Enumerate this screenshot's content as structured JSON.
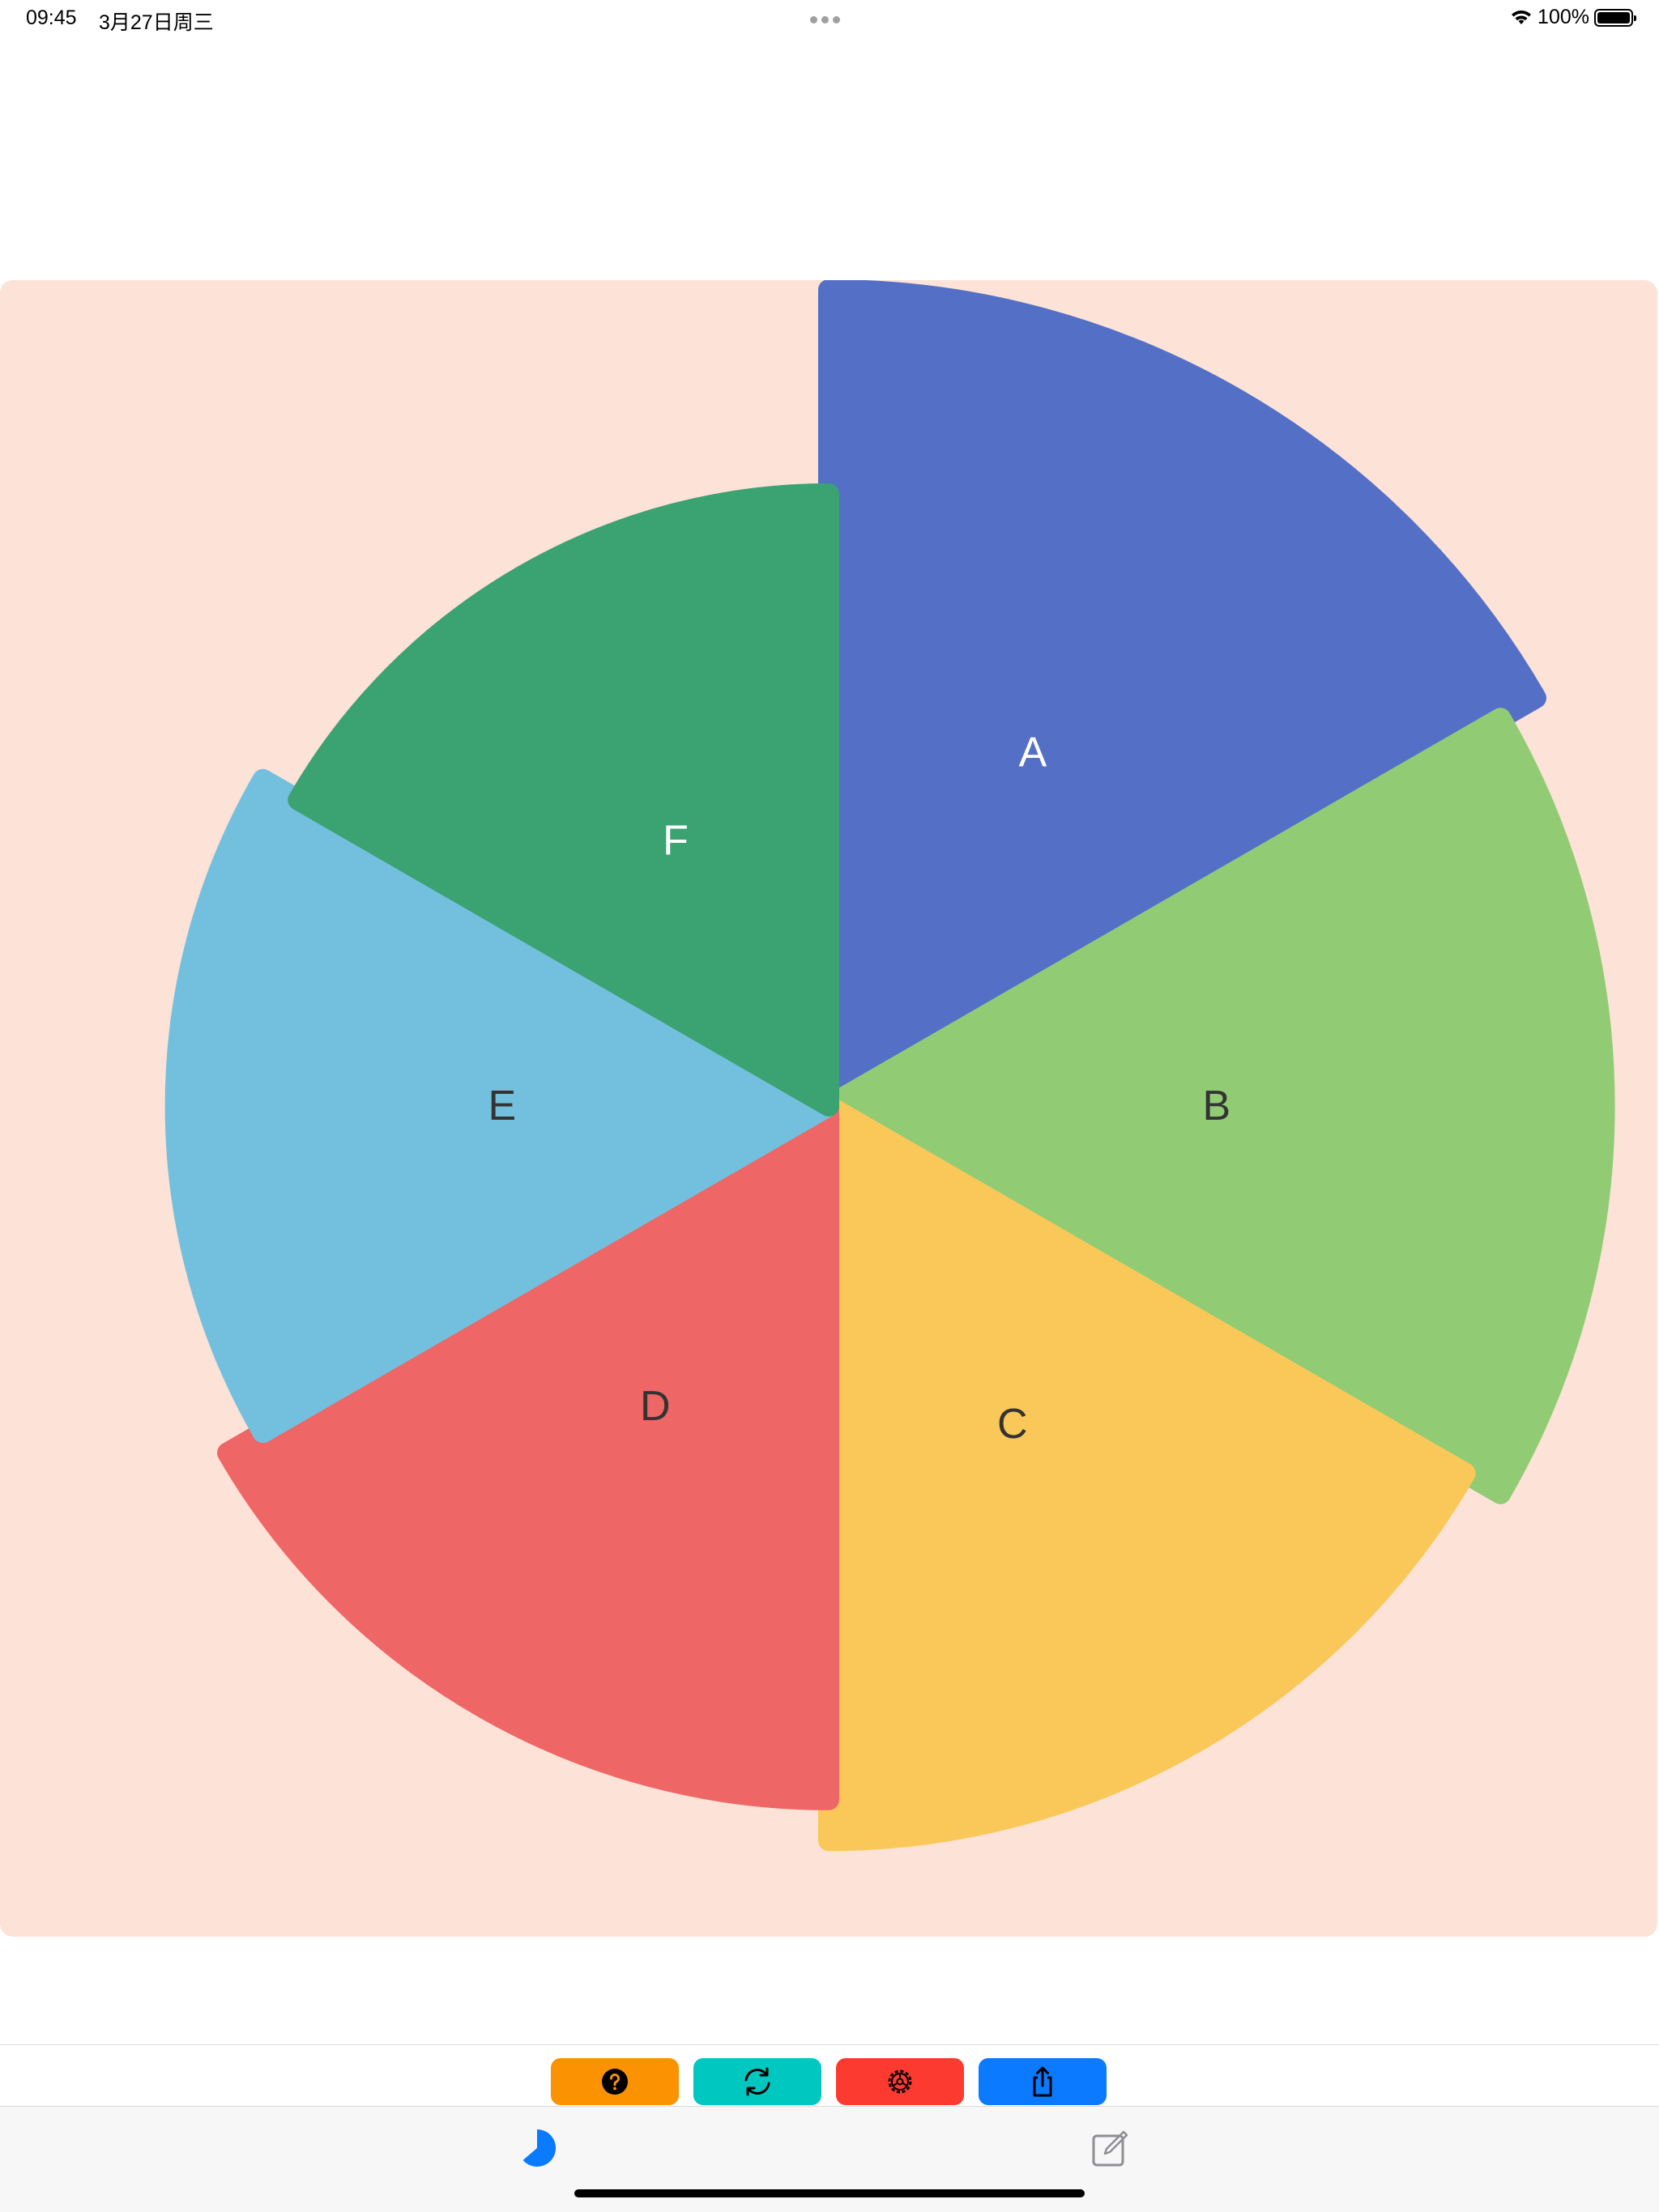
{
  "status_bar": {
    "time": "09:45",
    "date": "3月27日周三",
    "battery": "100%"
  },
  "chart_data": {
    "type": "pie",
    "variant": "nightingale-rose",
    "categories": [
      "A",
      "B",
      "C",
      "D",
      "E",
      "F"
    ],
    "values": [
      100,
      90,
      80,
      70,
      60,
      50
    ],
    "colors": [
      "#5470c6",
      "#91cc75",
      "#fac858",
      "#ee6666",
      "#73c0de",
      "#3ba272"
    ],
    "label_colors": [
      "#ffffff",
      "#333333",
      "#333333",
      "#333333",
      "#333333",
      "#ffffff"
    ],
    "start_angle_deg": 90,
    "clockwise": true,
    "background": "#fce2d7"
  },
  "toolbar": {
    "buttons": [
      {
        "name": "help",
        "icon": "question-circle-icon",
        "color": "#fb9202"
      },
      {
        "name": "refresh",
        "icon": "refresh-icon",
        "color": "#00c8c0"
      },
      {
        "name": "settings",
        "icon": "gear-icon",
        "color": "#fc3a30"
      },
      {
        "name": "share",
        "icon": "share-icon",
        "color": "#0b7aff"
      }
    ]
  },
  "tab_bar": {
    "tabs": [
      {
        "name": "chart",
        "icon": "pie-chart-icon",
        "active": true,
        "color": "#0a7aff"
      },
      {
        "name": "edit",
        "icon": "edit-icon",
        "active": false,
        "color": "#8e8e93"
      }
    ]
  }
}
